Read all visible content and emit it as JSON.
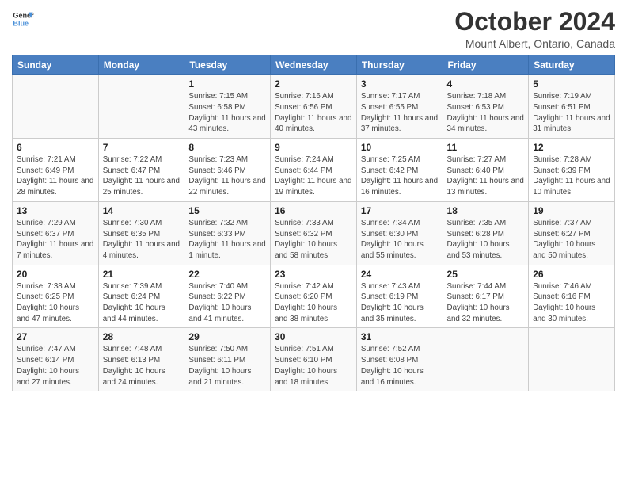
{
  "logo": {
    "text_general": "General",
    "text_blue": "Blue"
  },
  "header": {
    "title": "October 2024",
    "subtitle": "Mount Albert, Ontario, Canada"
  },
  "weekdays": [
    "Sunday",
    "Monday",
    "Tuesday",
    "Wednesday",
    "Thursday",
    "Friday",
    "Saturday"
  ],
  "weeks": [
    [
      {
        "day": "",
        "sunrise": "",
        "sunset": "",
        "daylight": ""
      },
      {
        "day": "",
        "sunrise": "",
        "sunset": "",
        "daylight": ""
      },
      {
        "day": "1",
        "sunrise": "Sunrise: 7:15 AM",
        "sunset": "Sunset: 6:58 PM",
        "daylight": "Daylight: 11 hours and 43 minutes."
      },
      {
        "day": "2",
        "sunrise": "Sunrise: 7:16 AM",
        "sunset": "Sunset: 6:56 PM",
        "daylight": "Daylight: 11 hours and 40 minutes."
      },
      {
        "day": "3",
        "sunrise": "Sunrise: 7:17 AM",
        "sunset": "Sunset: 6:55 PM",
        "daylight": "Daylight: 11 hours and 37 minutes."
      },
      {
        "day": "4",
        "sunrise": "Sunrise: 7:18 AM",
        "sunset": "Sunset: 6:53 PM",
        "daylight": "Daylight: 11 hours and 34 minutes."
      },
      {
        "day": "5",
        "sunrise": "Sunrise: 7:19 AM",
        "sunset": "Sunset: 6:51 PM",
        "daylight": "Daylight: 11 hours and 31 minutes."
      }
    ],
    [
      {
        "day": "6",
        "sunrise": "Sunrise: 7:21 AM",
        "sunset": "Sunset: 6:49 PM",
        "daylight": "Daylight: 11 hours and 28 minutes."
      },
      {
        "day": "7",
        "sunrise": "Sunrise: 7:22 AM",
        "sunset": "Sunset: 6:47 PM",
        "daylight": "Daylight: 11 hours and 25 minutes."
      },
      {
        "day": "8",
        "sunrise": "Sunrise: 7:23 AM",
        "sunset": "Sunset: 6:46 PM",
        "daylight": "Daylight: 11 hours and 22 minutes."
      },
      {
        "day": "9",
        "sunrise": "Sunrise: 7:24 AM",
        "sunset": "Sunset: 6:44 PM",
        "daylight": "Daylight: 11 hours and 19 minutes."
      },
      {
        "day": "10",
        "sunrise": "Sunrise: 7:25 AM",
        "sunset": "Sunset: 6:42 PM",
        "daylight": "Daylight: 11 hours and 16 minutes."
      },
      {
        "day": "11",
        "sunrise": "Sunrise: 7:27 AM",
        "sunset": "Sunset: 6:40 PM",
        "daylight": "Daylight: 11 hours and 13 minutes."
      },
      {
        "day": "12",
        "sunrise": "Sunrise: 7:28 AM",
        "sunset": "Sunset: 6:39 PM",
        "daylight": "Daylight: 11 hours and 10 minutes."
      }
    ],
    [
      {
        "day": "13",
        "sunrise": "Sunrise: 7:29 AM",
        "sunset": "Sunset: 6:37 PM",
        "daylight": "Daylight: 11 hours and 7 minutes."
      },
      {
        "day": "14",
        "sunrise": "Sunrise: 7:30 AM",
        "sunset": "Sunset: 6:35 PM",
        "daylight": "Daylight: 11 hours and 4 minutes."
      },
      {
        "day": "15",
        "sunrise": "Sunrise: 7:32 AM",
        "sunset": "Sunset: 6:33 PM",
        "daylight": "Daylight: 11 hours and 1 minute."
      },
      {
        "day": "16",
        "sunrise": "Sunrise: 7:33 AM",
        "sunset": "Sunset: 6:32 PM",
        "daylight": "Daylight: 10 hours and 58 minutes."
      },
      {
        "day": "17",
        "sunrise": "Sunrise: 7:34 AM",
        "sunset": "Sunset: 6:30 PM",
        "daylight": "Daylight: 10 hours and 55 minutes."
      },
      {
        "day": "18",
        "sunrise": "Sunrise: 7:35 AM",
        "sunset": "Sunset: 6:28 PM",
        "daylight": "Daylight: 10 hours and 53 minutes."
      },
      {
        "day": "19",
        "sunrise": "Sunrise: 7:37 AM",
        "sunset": "Sunset: 6:27 PM",
        "daylight": "Daylight: 10 hours and 50 minutes."
      }
    ],
    [
      {
        "day": "20",
        "sunrise": "Sunrise: 7:38 AM",
        "sunset": "Sunset: 6:25 PM",
        "daylight": "Daylight: 10 hours and 47 minutes."
      },
      {
        "day": "21",
        "sunrise": "Sunrise: 7:39 AM",
        "sunset": "Sunset: 6:24 PM",
        "daylight": "Daylight: 10 hours and 44 minutes."
      },
      {
        "day": "22",
        "sunrise": "Sunrise: 7:40 AM",
        "sunset": "Sunset: 6:22 PM",
        "daylight": "Daylight: 10 hours and 41 minutes."
      },
      {
        "day": "23",
        "sunrise": "Sunrise: 7:42 AM",
        "sunset": "Sunset: 6:20 PM",
        "daylight": "Daylight: 10 hours and 38 minutes."
      },
      {
        "day": "24",
        "sunrise": "Sunrise: 7:43 AM",
        "sunset": "Sunset: 6:19 PM",
        "daylight": "Daylight: 10 hours and 35 minutes."
      },
      {
        "day": "25",
        "sunrise": "Sunrise: 7:44 AM",
        "sunset": "Sunset: 6:17 PM",
        "daylight": "Daylight: 10 hours and 32 minutes."
      },
      {
        "day": "26",
        "sunrise": "Sunrise: 7:46 AM",
        "sunset": "Sunset: 6:16 PM",
        "daylight": "Daylight: 10 hours and 30 minutes."
      }
    ],
    [
      {
        "day": "27",
        "sunrise": "Sunrise: 7:47 AM",
        "sunset": "Sunset: 6:14 PM",
        "daylight": "Daylight: 10 hours and 27 minutes."
      },
      {
        "day": "28",
        "sunrise": "Sunrise: 7:48 AM",
        "sunset": "Sunset: 6:13 PM",
        "daylight": "Daylight: 10 hours and 24 minutes."
      },
      {
        "day": "29",
        "sunrise": "Sunrise: 7:50 AM",
        "sunset": "Sunset: 6:11 PM",
        "daylight": "Daylight: 10 hours and 21 minutes."
      },
      {
        "day": "30",
        "sunrise": "Sunrise: 7:51 AM",
        "sunset": "Sunset: 6:10 PM",
        "daylight": "Daylight: 10 hours and 18 minutes."
      },
      {
        "day": "31",
        "sunrise": "Sunrise: 7:52 AM",
        "sunset": "Sunset: 6:08 PM",
        "daylight": "Daylight: 10 hours and 16 minutes."
      },
      {
        "day": "",
        "sunrise": "",
        "sunset": "",
        "daylight": ""
      },
      {
        "day": "",
        "sunrise": "",
        "sunset": "",
        "daylight": ""
      }
    ]
  ]
}
